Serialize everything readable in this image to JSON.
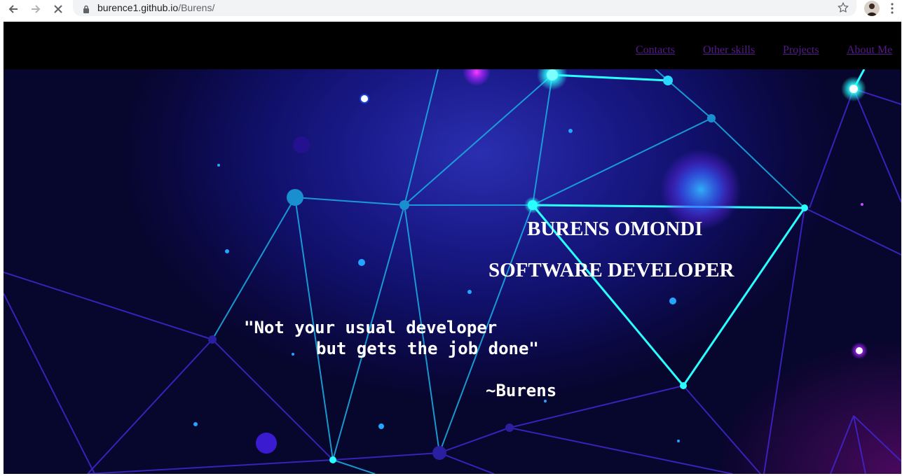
{
  "browser": {
    "url_host": "burence1.github.io",
    "url_path": "/Burens/",
    "icons": [
      "back-arrow-icon",
      "forward-arrow-icon",
      "stop-loading-icon",
      "lock-icon",
      "bookmark-star-icon",
      "menu-dots-icon"
    ]
  },
  "nav": {
    "links": [
      "Contacts",
      "Other skills",
      "Projects",
      "About Me"
    ]
  },
  "hero": {
    "name": "BURENS OMONDI",
    "role": "SOFTWARE DEVELOPER",
    "quote_line1": "\"Not your usual developer",
    "quote_line2": "but gets the job done\"",
    "signature": "~Burens"
  },
  "colors": {
    "nav_bg": "#000000",
    "link": "#551a8b",
    "network_line": "#19b8e6",
    "network_glow": "#2affff",
    "purple_line": "#4a2bd8"
  }
}
